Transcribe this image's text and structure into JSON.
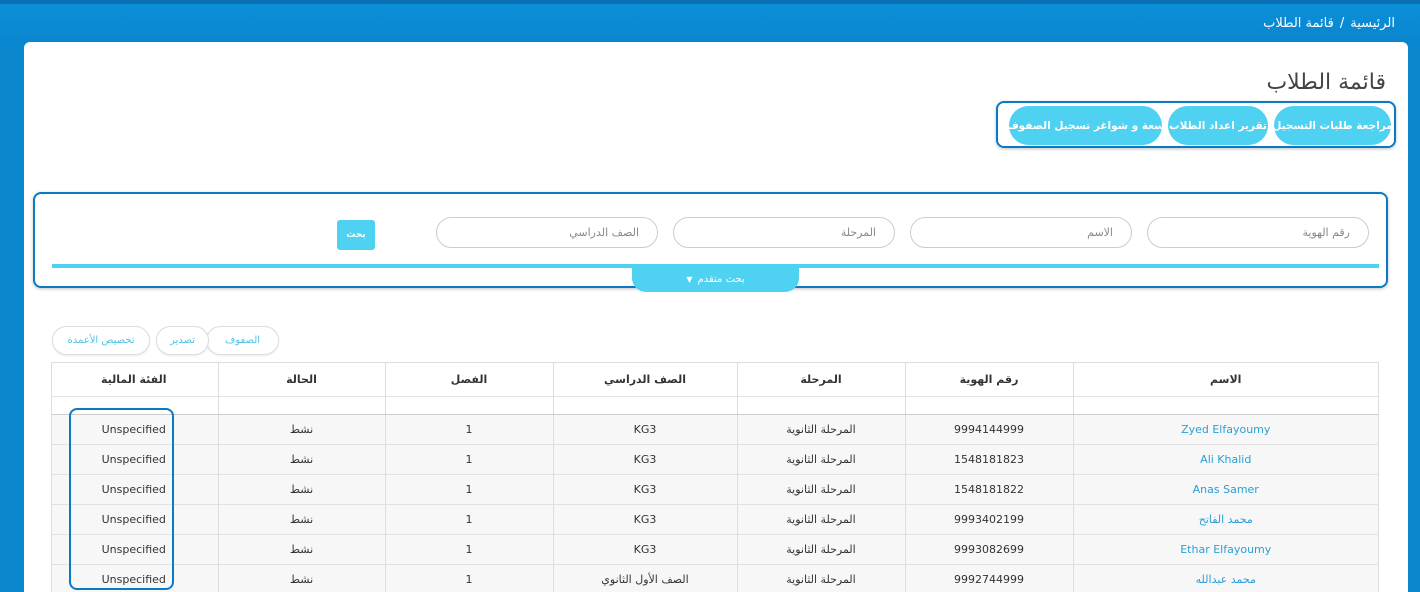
{
  "breadcrumb": {
    "home": "الرئيسية",
    "separator": "/",
    "current": "قائمة الطلاب"
  },
  "page": {
    "title": "قائمة الطلاب"
  },
  "actions": {
    "review_requests": "مراجعة طلبات التسجيل",
    "students_count_report": "تقرير اعداد الطلاب",
    "class_capacity": "سعة و شواغر تسجيل الصفوف"
  },
  "search": {
    "id_placeholder": "رقم الهوية",
    "name_placeholder": "الاسم",
    "stage_placeholder": "المرحلة",
    "grade_placeholder": "الصف الدراسي",
    "search_button": "بحث",
    "advanced_label": "بحث متقدم",
    "advanced_icon": "caret-down-icon"
  },
  "toolbar": {
    "rows": "الصفوف",
    "export": "تصدير",
    "customize_columns": "تخصيص الأعمدة"
  },
  "table": {
    "headers": {
      "name": "الاسم",
      "id": "رقم الهوية",
      "stage": "المرحلة",
      "grade": "الصف الدراسي",
      "section": "الفصل",
      "status": "الحالة",
      "financial": "الفئة المالية"
    },
    "rows": [
      {
        "name": "Zyed Elfayoumy",
        "id": "9994144999",
        "stage": "المرحلة الثانوية",
        "grade": "KG3",
        "section": "1",
        "status": "نشط",
        "financial": "Unspecified"
      },
      {
        "name": "Ali Khalid",
        "id": "1548181823",
        "stage": "المرحلة الثانوية",
        "grade": "KG3",
        "section": "1",
        "status": "نشط",
        "financial": "Unspecified"
      },
      {
        "name": "Anas Samer",
        "id": "1548181822",
        "stage": "المرحلة الثانوية",
        "grade": "KG3",
        "section": "1",
        "status": "نشط",
        "financial": "Unspecified"
      },
      {
        "name": "محمد الفاتح",
        "id": "9993402199",
        "stage": "المرحلة الثانوية",
        "grade": "KG3",
        "section": "1",
        "status": "نشط",
        "financial": "Unspecified"
      },
      {
        "name": "Ethar Elfayoumy",
        "id": "9993082699",
        "stage": "المرحلة الثانوية",
        "grade": "KG3",
        "section": "1",
        "status": "نشط",
        "financial": "Unspecified"
      },
      {
        "name": "محمد عبدالله",
        "id": "9992744999",
        "stage": "المرحلة الثانوية",
        "grade": "الصف الأول الثانوي",
        "section": "1",
        "status": "نشط",
        "financial": "Unspecified"
      }
    ]
  },
  "colors": {
    "header_blue": "#0a86cf",
    "accent_cyan": "#4fd1f2",
    "link_blue": "#2a9fd6",
    "highlight_border": "#0a7ac4"
  }
}
